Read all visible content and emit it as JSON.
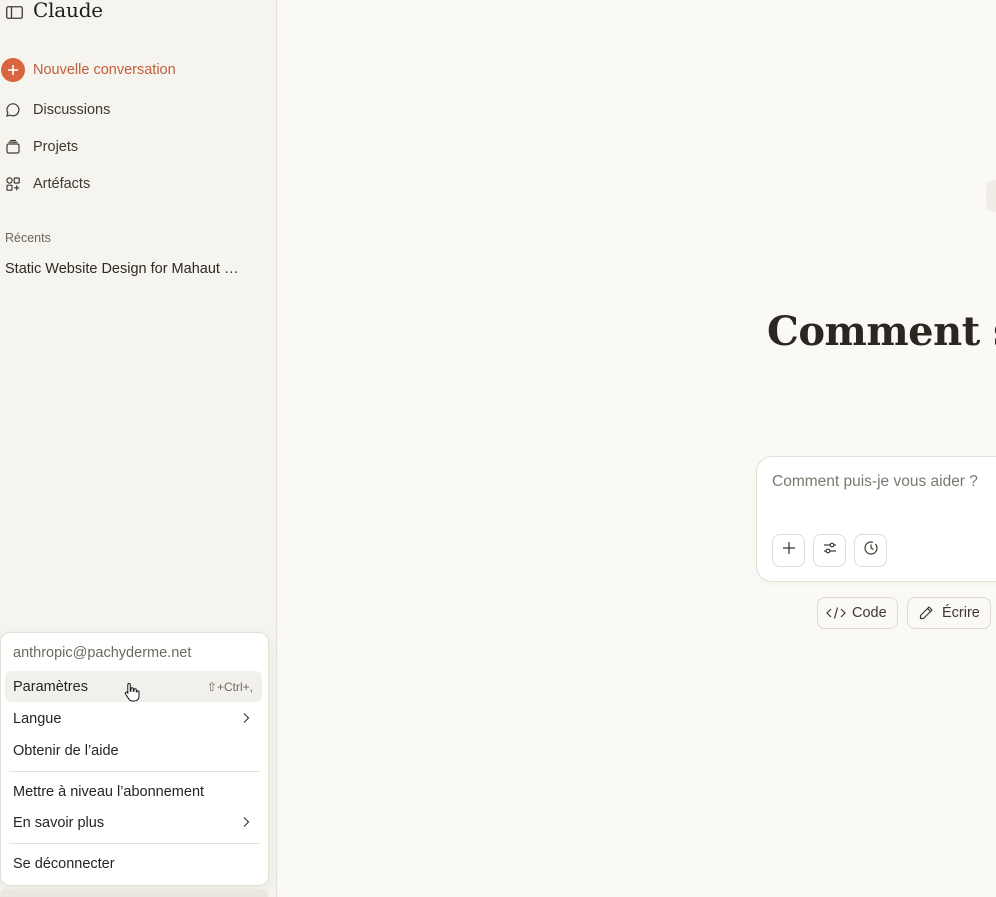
{
  "app": {
    "name": "Claude"
  },
  "sidebar": {
    "new_conversation": "Nouvelle conversation",
    "items": [
      {
        "label": "Discussions",
        "icon": "chat-bubble-icon"
      },
      {
        "label": "Projets",
        "icon": "folder-stack-icon"
      },
      {
        "label": "Artéfacts",
        "icon": "shapes-icon"
      }
    ],
    "recents_title": "Récents",
    "recents": [
      {
        "title": "Static Website Design for Mahaut …"
      }
    ]
  },
  "account_menu": {
    "email": "anthropic@pachyderme.net",
    "settings": {
      "label": "Paramètres",
      "shortcut": "⇧+Ctrl+,"
    },
    "language": "Langue",
    "help": "Obtenir de l’aide",
    "upgrade": "Mettre à niveau l’abonnement",
    "learn_more": "En savoir plus",
    "logout": "Se déconnecter"
  },
  "main": {
    "greeting": "Comment s’en",
    "composer": {
      "placeholder": "Comment puis-je vous aider ?"
    },
    "chips": [
      {
        "label": "Code",
        "icon": "code-icon"
      },
      {
        "label": "Écrire",
        "icon": "pencil-icon"
      }
    ]
  },
  "colors": {
    "accent": "#d9653f",
    "background": "#faf9f5",
    "sidebar": "#f5f4ee"
  }
}
